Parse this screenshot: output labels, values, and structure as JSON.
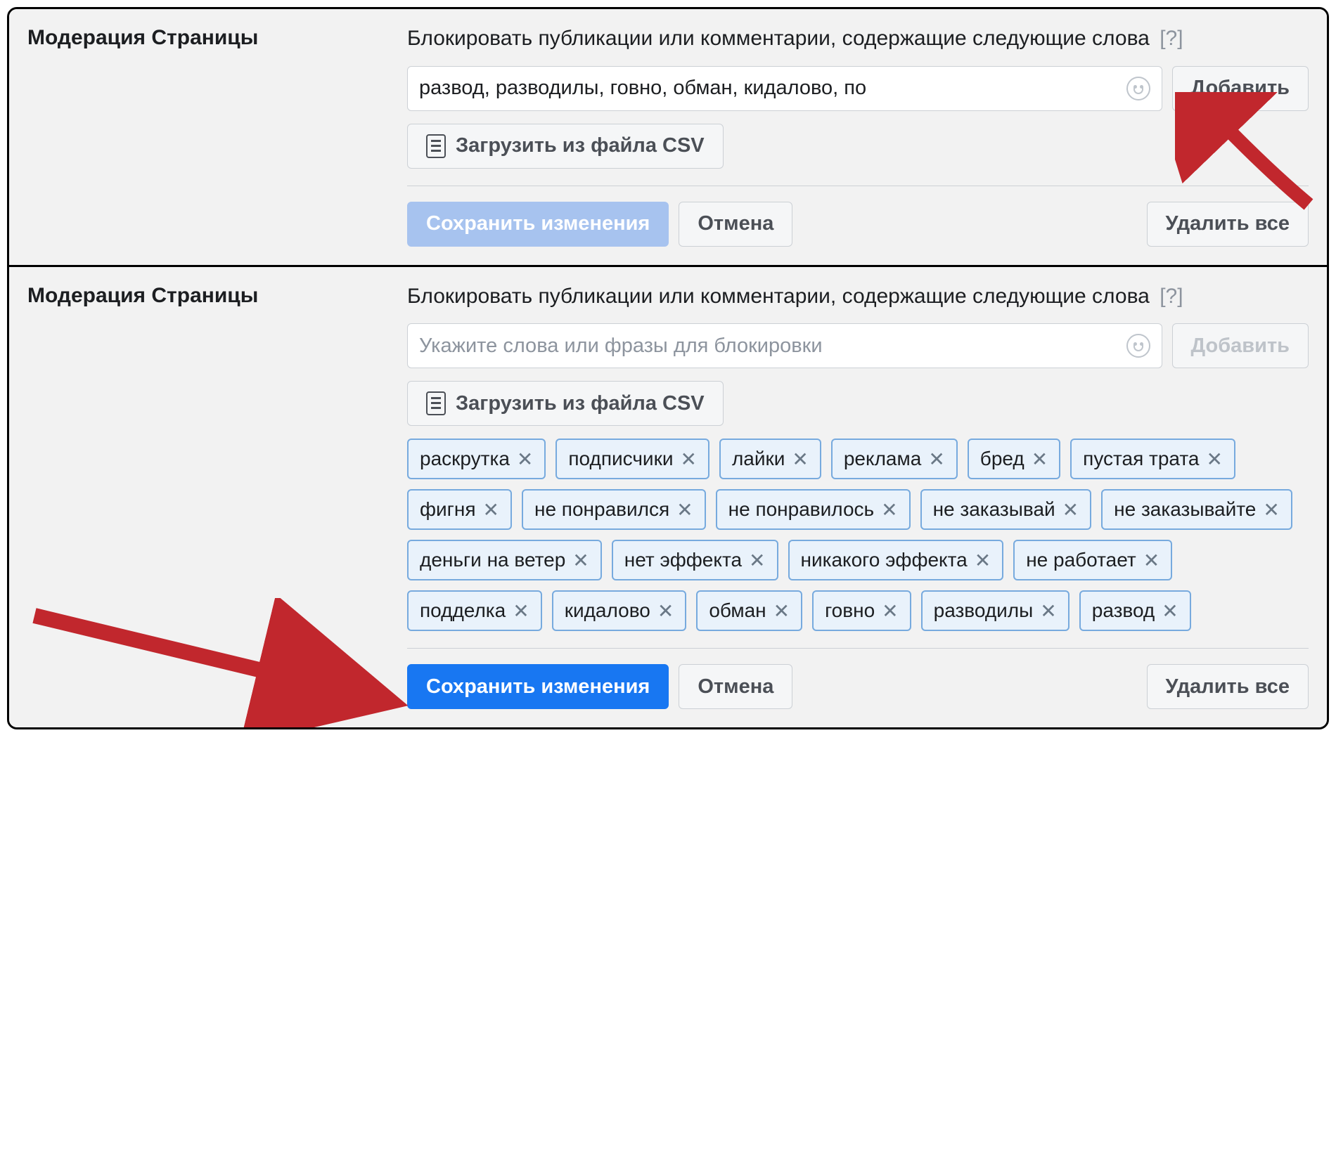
{
  "panel1": {
    "section_title": "Модерация Страницы",
    "description": "Блокировать публикации или комментарии, содержащие следующие слова",
    "help_marker": "[?]",
    "input_value": "развод, разводилы, говно, обман, кидалово, по",
    "add_button": "Добавить",
    "csv_button": "Загрузить из файла CSV",
    "save_button": "Сохранить изменения",
    "cancel_button": "Отмена",
    "delete_all_button": "Удалить все"
  },
  "panel2": {
    "section_title": "Модерация Страницы",
    "description": "Блокировать публикации или комментарии, содержащие следующие слова",
    "help_marker": "[?]",
    "input_placeholder": "Укажите слова или фразы для блокировки",
    "add_button": "Добавить",
    "csv_button": "Загрузить из файла CSV",
    "tags": [
      "раскрутка",
      "подписчики",
      "лайки",
      "реклама",
      "бред",
      "пустая трата",
      "фигня",
      "не понравился",
      "не понравилось",
      "не заказывай",
      "не заказывайте",
      "деньги на ветер",
      "нет эффекта",
      "никакого эффекта",
      "не работает",
      "подделка",
      "кидалово",
      "обман",
      "говно",
      "разводилы",
      "развод"
    ],
    "save_button": "Сохранить изменения",
    "cancel_button": "Отмена",
    "delete_all_button": "Удалить все"
  }
}
